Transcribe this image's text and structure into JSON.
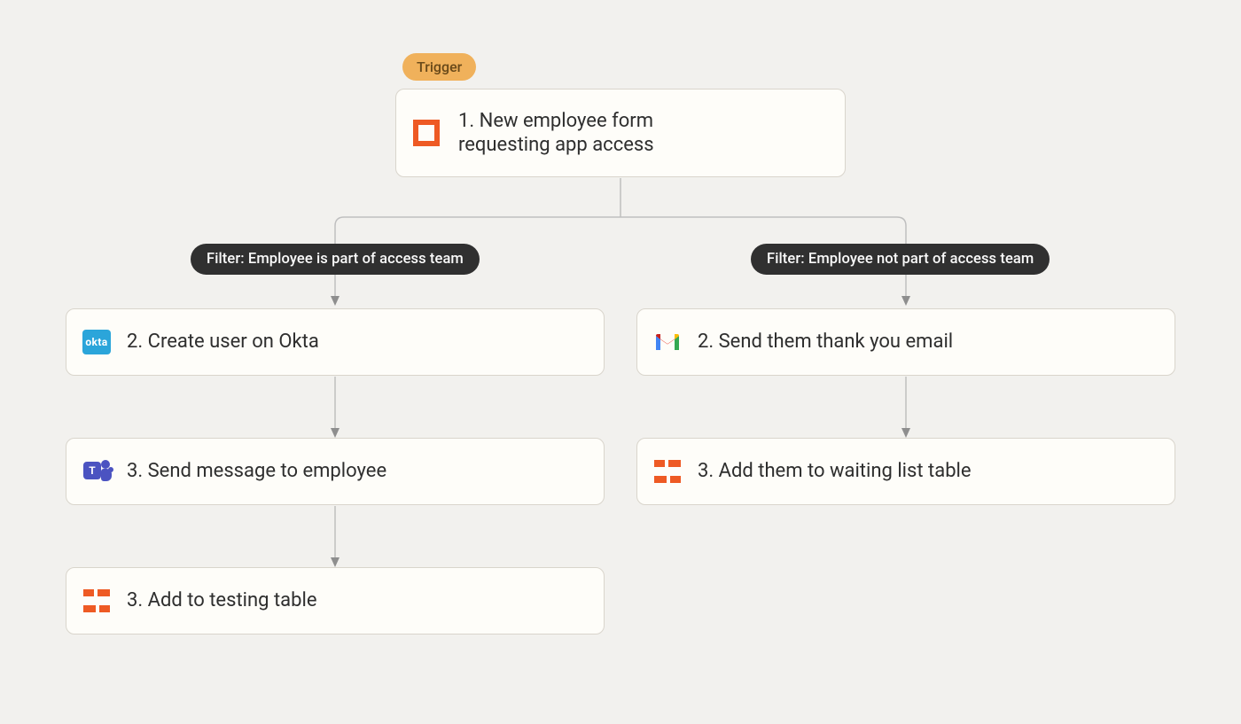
{
  "trigger_badge": "Trigger",
  "trigger_card": {
    "label_line1": "1. New employee form",
    "label_line2": "requesting app access"
  },
  "branches": {
    "left": {
      "filter": "Filter:  Employee is part of access team",
      "steps": [
        {
          "icon": "okta",
          "label": "2. Create user on Okta"
        },
        {
          "icon": "teams",
          "label": "3. Send message to employee"
        },
        {
          "icon": "stax",
          "label": "3. Add to testing table"
        }
      ]
    },
    "right": {
      "filter": "Filter: Employee not part of access team",
      "steps": [
        {
          "icon": "gmail",
          "label": "2. Send them thank you email"
        },
        {
          "icon": "stax",
          "label": "3. Add them to waiting list table"
        }
      ]
    }
  }
}
